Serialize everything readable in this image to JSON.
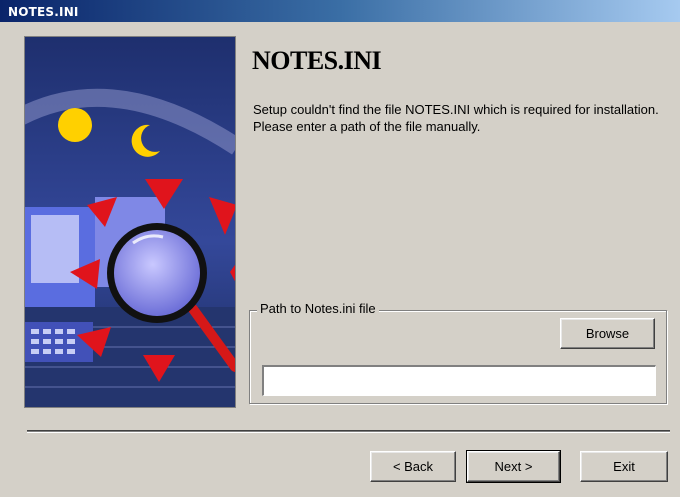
{
  "window": {
    "title": "NOTES.INI"
  },
  "main": {
    "heading": "NOTES.INI",
    "message": "Setup couldn't find the file NOTES.INI which is required for installation. Please enter a path of the file manually."
  },
  "path_group": {
    "label": "Path to Notes.ini file",
    "browse_label": "Browse",
    "path_value": "",
    "path_placeholder": ""
  },
  "footer": {
    "back_label": "< Back",
    "next_label": "Next >",
    "exit_label": "Exit"
  },
  "colors": {
    "titlebar_start": "#0a246a",
    "titlebar_end": "#a6caf0",
    "dialog_bg": "#d4d0c8"
  },
  "artwork": {
    "icons": [
      "sun-icon",
      "moon-icon",
      "computer-icon",
      "magnifier-icon",
      "arrow-icon"
    ]
  }
}
